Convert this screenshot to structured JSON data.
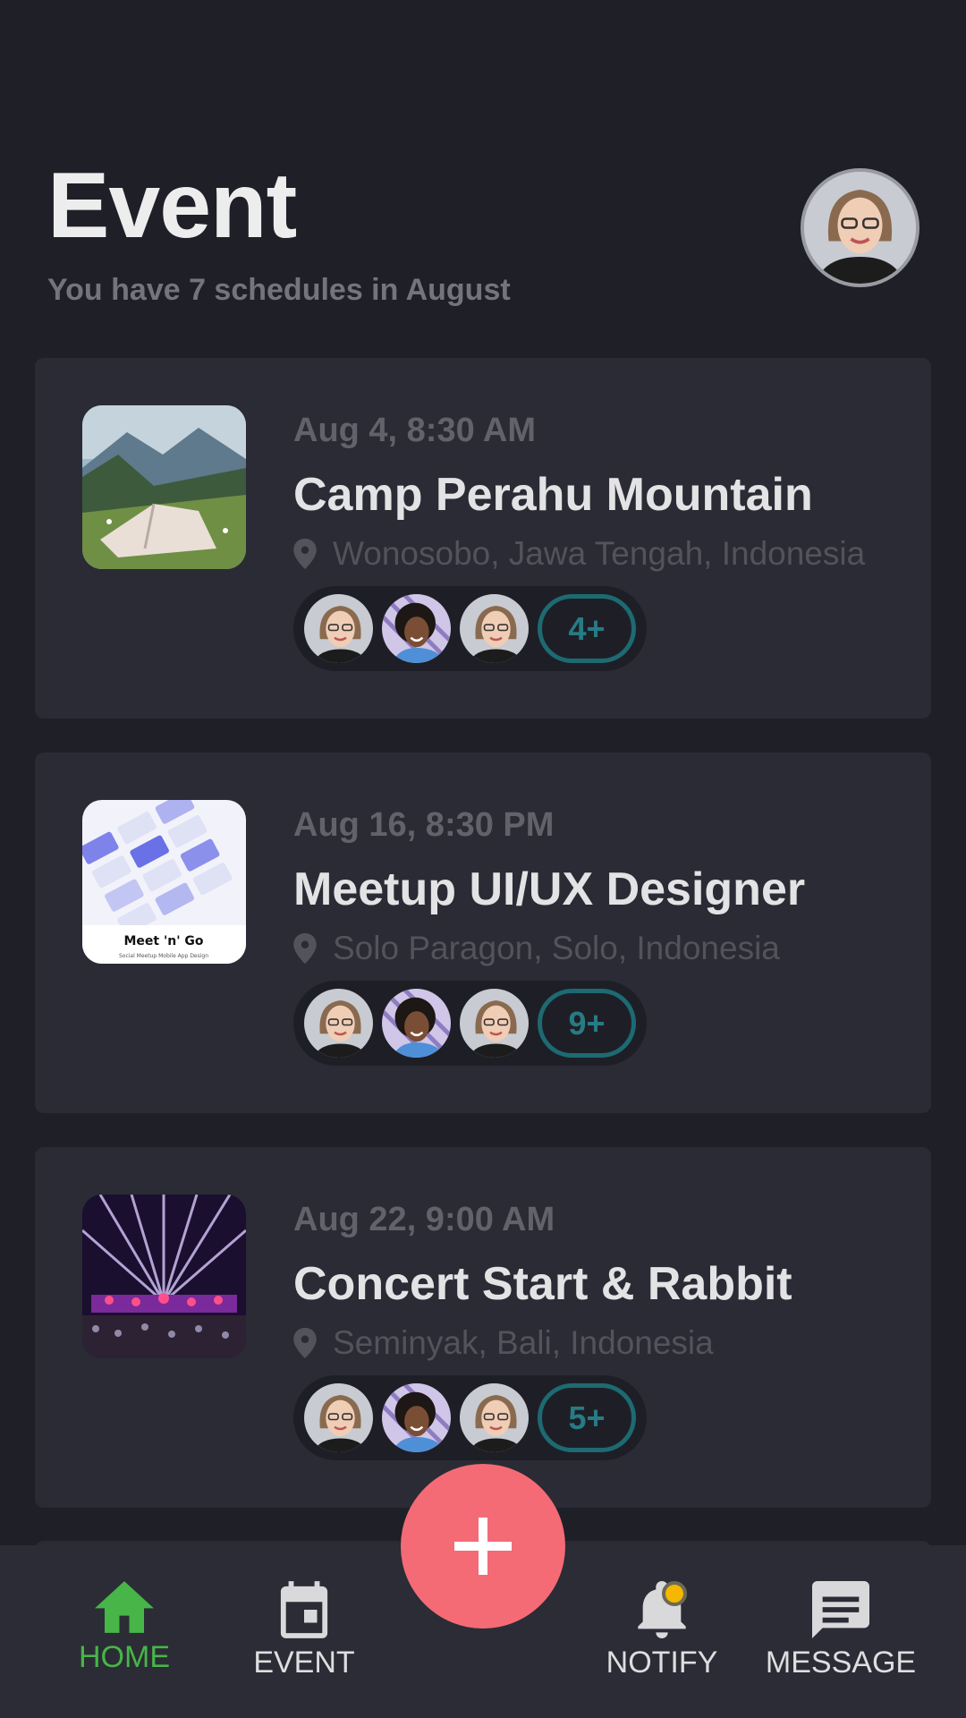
{
  "header": {
    "title": "Event",
    "subtitle": "You have 7 schedules in August"
  },
  "events": [
    {
      "date": "Aug 4, 8:30 AM",
      "title": "Camp Perahu Mountain",
      "location": "Wonosobo, Jawa Tengah, Indonesia",
      "more": "4+",
      "thumb": "mountain-camp-photo"
    },
    {
      "date": "Aug 16, 8:30 PM",
      "title": "Meetup UI/UX Designer",
      "location": "Solo Paragon, Solo, Indonesia",
      "more": "9+",
      "thumb": "meetup-app-design-image",
      "thumb_caption": "Meet 'n' Go",
      "thumb_subcaption": "Social Meetup Mobile App Design"
    },
    {
      "date": "Aug 22, 9:00 AM",
      "title": "Concert Start & Rabbit",
      "location": "Seminyak, Bali, Indonesia",
      "more": "5+",
      "thumb": "concert-stage-photo"
    }
  ],
  "nav": {
    "home": "HOME",
    "event": "EVENT",
    "notify": "NOTIFY",
    "message": "MESSAGE"
  },
  "colors": {
    "background": "#1f2027",
    "card": "#2a2b34",
    "active": "#47b548",
    "fab": "#f46b76",
    "badge": "#1d6a72",
    "notify_dot": "#f5b700"
  }
}
